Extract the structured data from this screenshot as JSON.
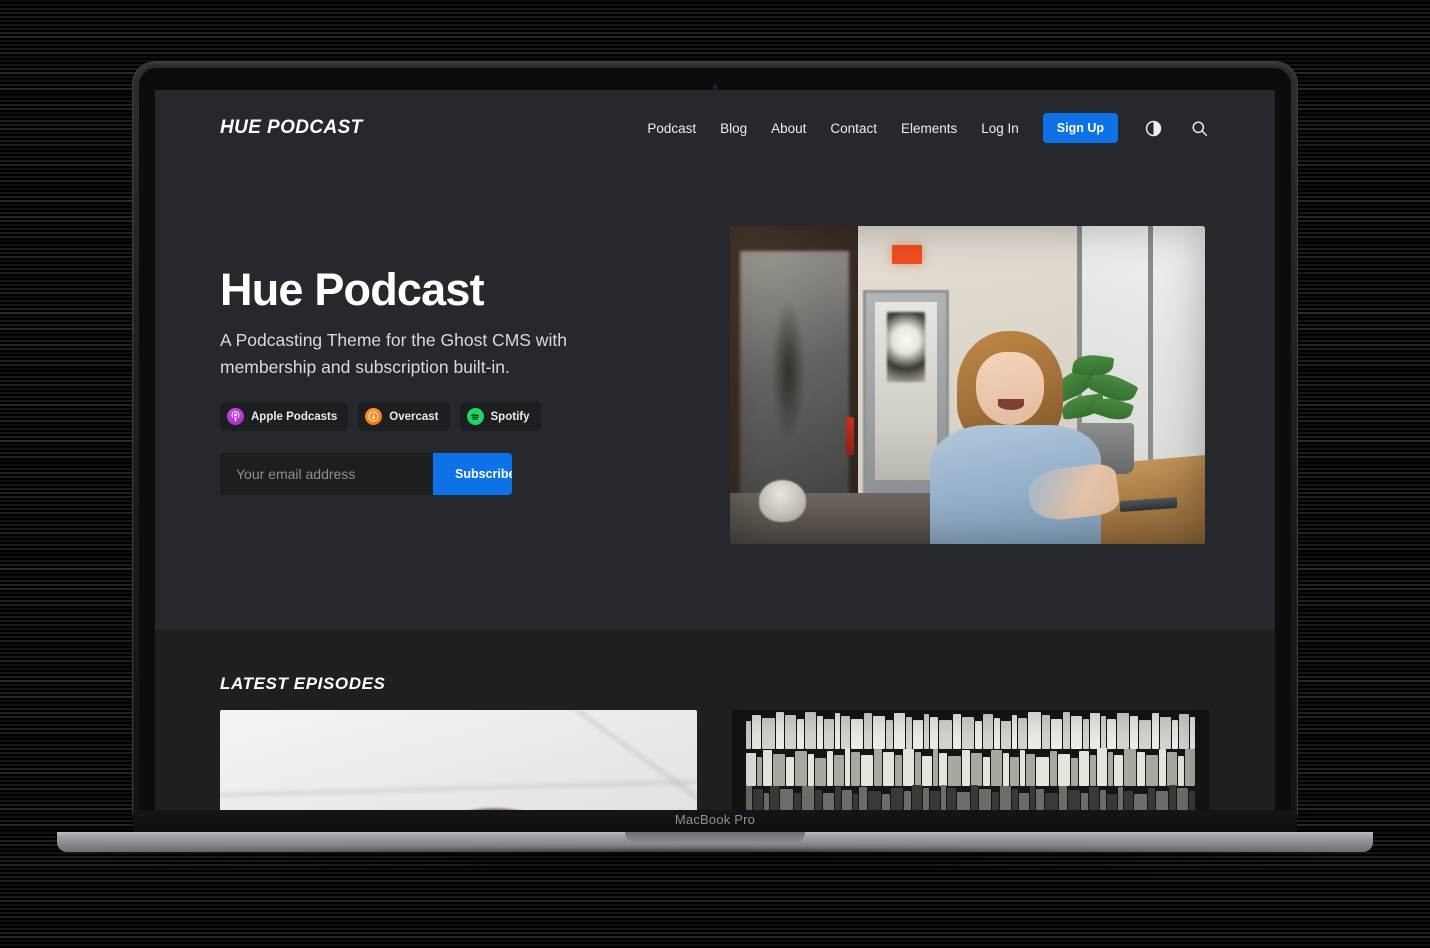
{
  "device": {
    "model_label": "MacBook Pro"
  },
  "site": {
    "logo": "HUE PODCAST",
    "nav": {
      "links": [
        {
          "label": "Podcast",
          "name": "nav-link-podcast"
        },
        {
          "label": "Blog",
          "name": "nav-link-blog"
        },
        {
          "label": "About",
          "name": "nav-link-about"
        },
        {
          "label": "Contact",
          "name": "nav-link-contact"
        },
        {
          "label": "Elements",
          "name": "nav-link-elements"
        },
        {
          "label": "Log In",
          "name": "nav-link-login"
        }
      ],
      "signup_label": "Sign Up",
      "theme_toggle_icon": "contrast-icon",
      "search_icon": "search-icon"
    },
    "hero": {
      "title": "Hue Podcast",
      "subtitle": "A Podcasting Theme for the Ghost CMS with membership and subscription built-in.",
      "badges": [
        {
          "label": "Apple Podcasts",
          "icon": "apple-podcasts-icon",
          "color": "#b936d6"
        },
        {
          "label": "Overcast",
          "icon": "overcast-icon",
          "color": "#fc7e0f"
        },
        {
          "label": "Spotify",
          "icon": "spotify-icon",
          "color": "#1ed760"
        }
      ],
      "email_placeholder": "Your email address",
      "email_value": "",
      "subscribe_label": "Subscribe",
      "image_alt": "Smiling woman with red hair in a blue denim shirt sitting at a wooden counter by a window in a bright cafe"
    },
    "latest": {
      "heading": "LATEST EPISODES",
      "episodes": [
        {
          "image_alt": "Top of a person's head against a bright white ceiling"
        },
        {
          "image_alt": "Black and white photo of tall bookshelves filled with books"
        }
      ]
    },
    "colors": {
      "hero_background": "#25282c",
      "lower_background": "#1e1f21",
      "accent_blue": "#0d72e8",
      "input_background": "#1c1e20",
      "text_primary": "#ffffff",
      "text_secondary": "#d8dadc"
    }
  }
}
